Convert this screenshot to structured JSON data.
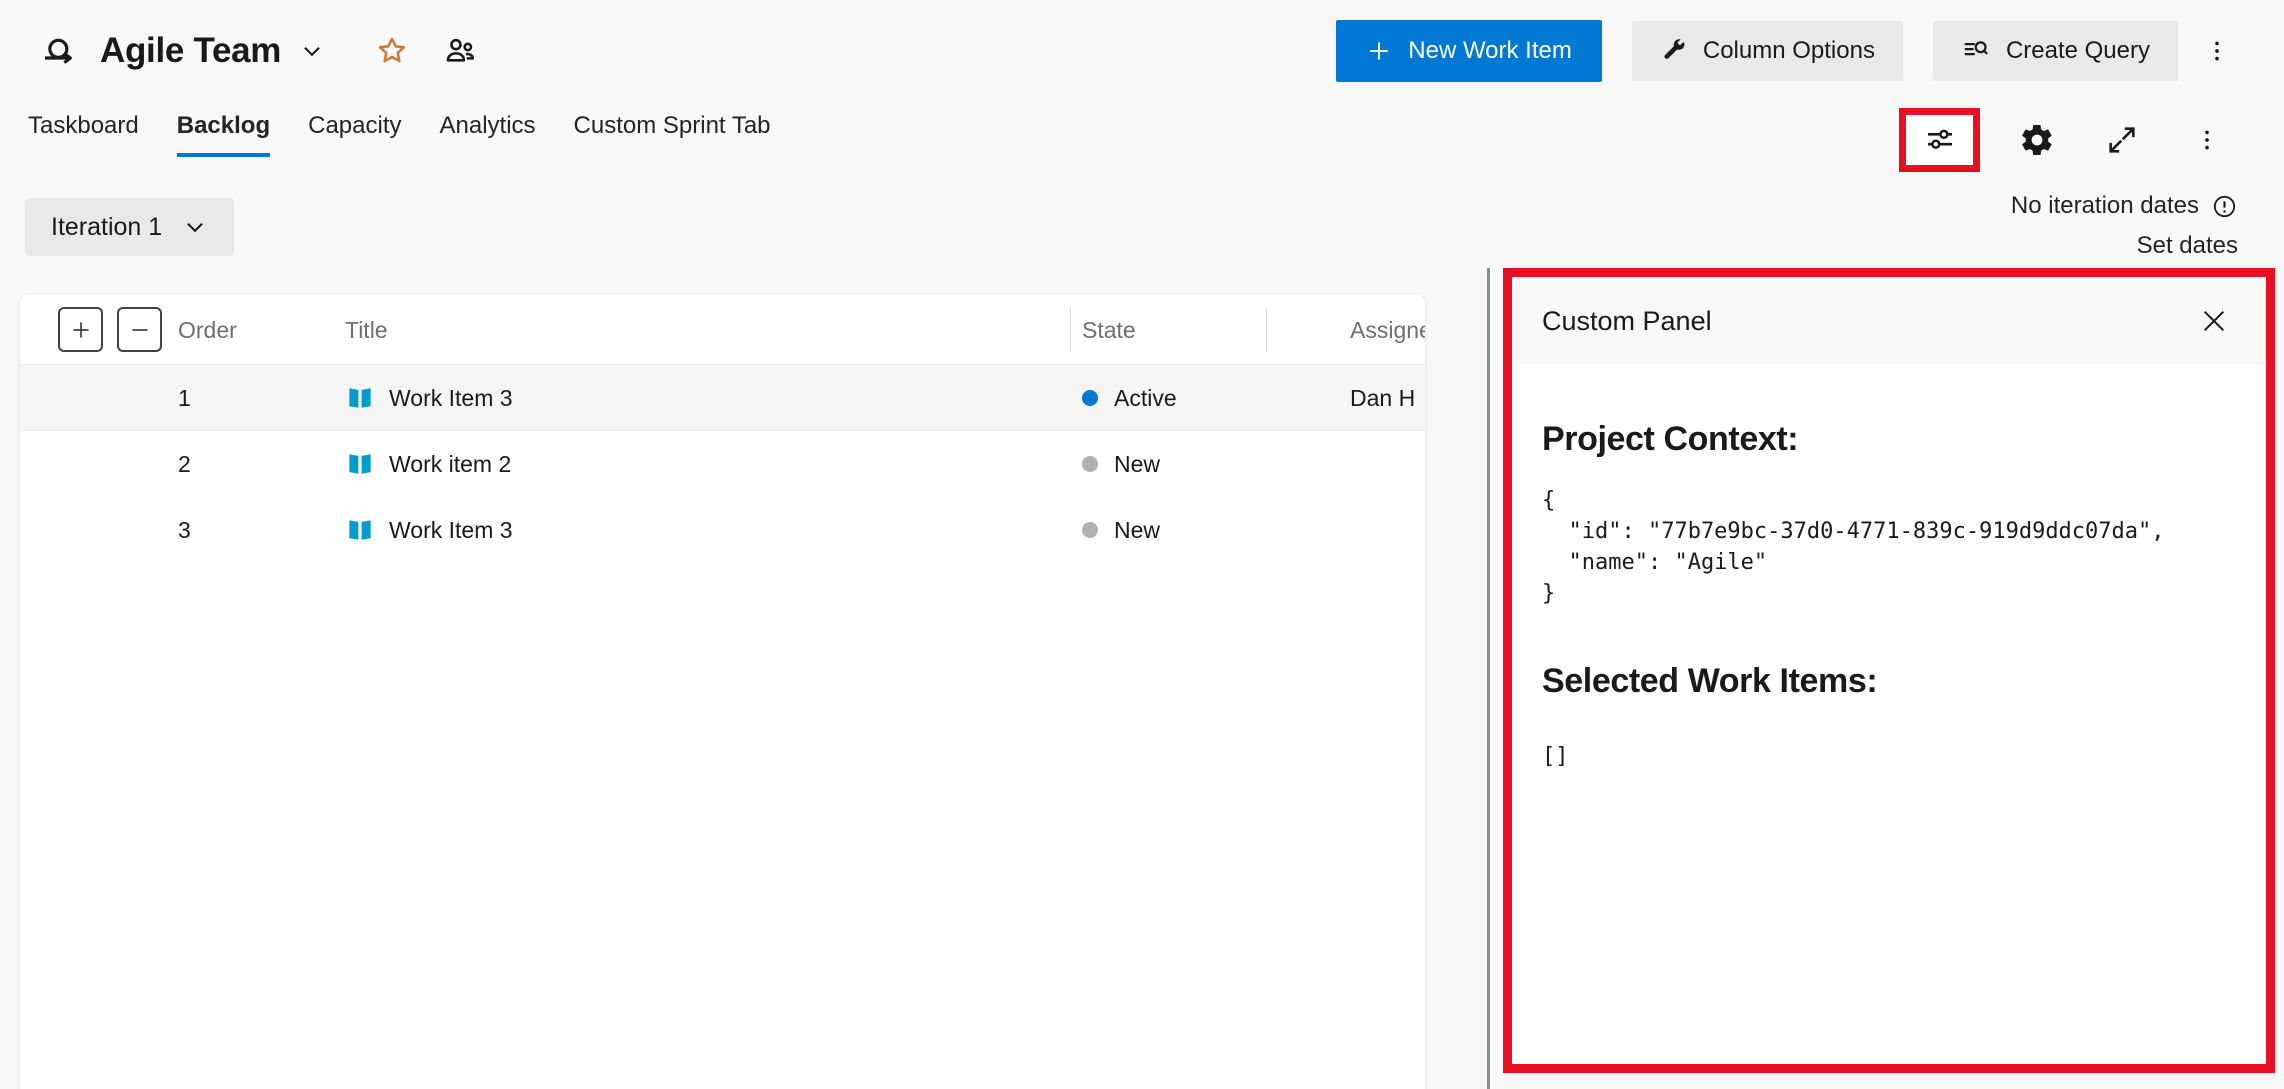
{
  "header": {
    "team_name": "Agile Team",
    "actions": {
      "new_work_item": "New Work Item",
      "column_options": "Column Options",
      "create_query": "Create Query"
    }
  },
  "tabs": {
    "items": [
      {
        "label": "Taskboard",
        "active": false
      },
      {
        "label": "Backlog",
        "active": true
      },
      {
        "label": "Capacity",
        "active": false
      },
      {
        "label": "Analytics",
        "active": false
      },
      {
        "label": "Custom Sprint Tab",
        "active": false
      }
    ]
  },
  "iteration": {
    "selector_label": "Iteration 1",
    "no_dates_text": "No iteration dates",
    "set_dates_link": "Set dates"
  },
  "backlog_table": {
    "columns": {
      "order": "Order",
      "title": "Title",
      "state": "State",
      "assigned_to": "Assigned To"
    },
    "rows": [
      {
        "order": "1",
        "title": "Work Item 3",
        "state": "Active",
        "assigned_to": "Dan H"
      },
      {
        "order": "2",
        "title": "Work item 2",
        "state": "New",
        "assigned_to": ""
      },
      {
        "order": "3",
        "title": "Work Item 3",
        "state": "New",
        "assigned_to": ""
      }
    ]
  },
  "panel": {
    "title": "Custom Panel",
    "project_context_heading": "Project Context:",
    "project_context_json": "{\n  \"id\": \"77b7e9bc-37d0-4771-839c-919d9ddc07da\",\n  \"name\": \"Agile\"\n}",
    "selected_items_heading": "Selected Work Items:",
    "selected_items_json": "[]"
  },
  "colors": {
    "accent_blue": "#0078d4",
    "highlight_red": "#e81123",
    "work_item_type_icon": "#009ccc",
    "state_active_dot": "#0078d4",
    "state_new_dot": "#b2b2b2",
    "favorite_star": "#ca7a38"
  },
  "icons": {
    "sprint": "loop-arrow",
    "team_dropdown": "chevron-down",
    "favorite": "star-outline",
    "team_members": "two-people",
    "new_work_item": "plus",
    "column_options": "wrench",
    "create_query": "list-magnifier",
    "more_options": "vertical-ellipsis",
    "filter": "sliders",
    "settings": "gear",
    "fullscreen": "diagonal-arrows",
    "iteration_info": "exclamation-circle",
    "expand_all": "plus-square",
    "collapse_all": "minus-square",
    "work_item_type": "open-book",
    "panel_close": "x"
  }
}
